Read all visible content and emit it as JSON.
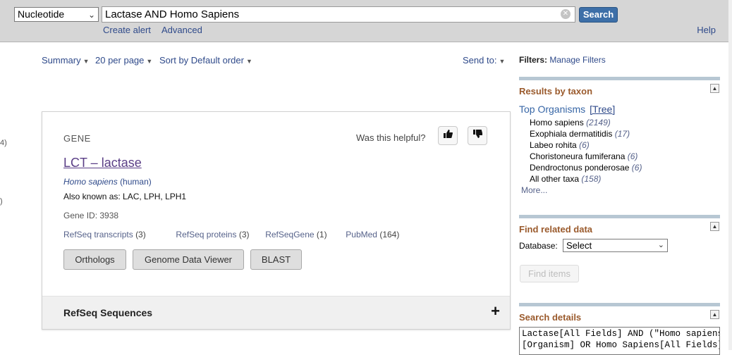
{
  "topbar": {
    "database": "Nucleotide",
    "query": "Lactase AND Homo Sapiens",
    "search_label": "Search",
    "create_alert": "Create alert",
    "advanced": "Advanced",
    "help": "Help"
  },
  "left_markers": [
    "4)",
    ")"
  ],
  "controls": {
    "summary": "Summary",
    "per_page": "20 per page",
    "sort": "Sort by Default order",
    "send_to": "Send to:"
  },
  "gene_card": {
    "kicker": "GENE",
    "helpful": "Was this helpful?",
    "title": "LCT – lactase",
    "species": "Homo sapiens",
    "common_name": "(human)",
    "aka": "Also known as: LAC, LPH, LPH1",
    "gene_id": "Gene ID: 3938",
    "links": [
      {
        "label": "RefSeq transcripts",
        "count": "(3)"
      },
      {
        "label": "RefSeq proteins",
        "count": "(3)"
      },
      {
        "label": "RefSeqGene",
        "count": "(1)"
      },
      {
        "label": "PubMed",
        "count": "(164)"
      }
    ],
    "buttons": [
      "Orthologs",
      "Genome Data Viewer",
      "BLAST"
    ],
    "refseq_section": "RefSeq Sequences",
    "expand_symbol": "+"
  },
  "sidebar": {
    "filters_label": "Filters:",
    "manage_filters": "Manage Filters",
    "taxon_heading": "Results by taxon",
    "top_organisms": "Top Organisms",
    "tree": "[Tree]",
    "taxa": [
      {
        "name": "Homo sapiens",
        "count": "(2149)"
      },
      {
        "name": "Exophiala dermatitidis",
        "count": "(17)"
      },
      {
        "name": "Labeo rohita",
        "count": "(6)"
      },
      {
        "name": "Choristoneura fumiferana",
        "count": "(6)"
      },
      {
        "name": "Dendroctonus ponderosae",
        "count": "(6)"
      },
      {
        "name": "All other taxa",
        "count": "(158)"
      }
    ],
    "more": "More...",
    "related_heading": "Find related data",
    "database_label": "Database:",
    "database_select": "Select",
    "find_items": "Find items",
    "details_heading": "Search details",
    "details_text": "Lactase[All Fields] AND (\"Homo sapiens\"\n[Organism] OR Homo Sapiens[All Fields])"
  },
  "colors": {
    "link": "#2f4a8a",
    "search_button": "#3d6fa8",
    "panel_heading": "#9a5a2c",
    "panel_bar": "#b7c7d3"
  },
  "icons": [
    "clear-icon",
    "thumbs-up-icon",
    "thumbs-down-icon",
    "caret-down-icon",
    "collapse-icon",
    "plus-icon"
  ]
}
